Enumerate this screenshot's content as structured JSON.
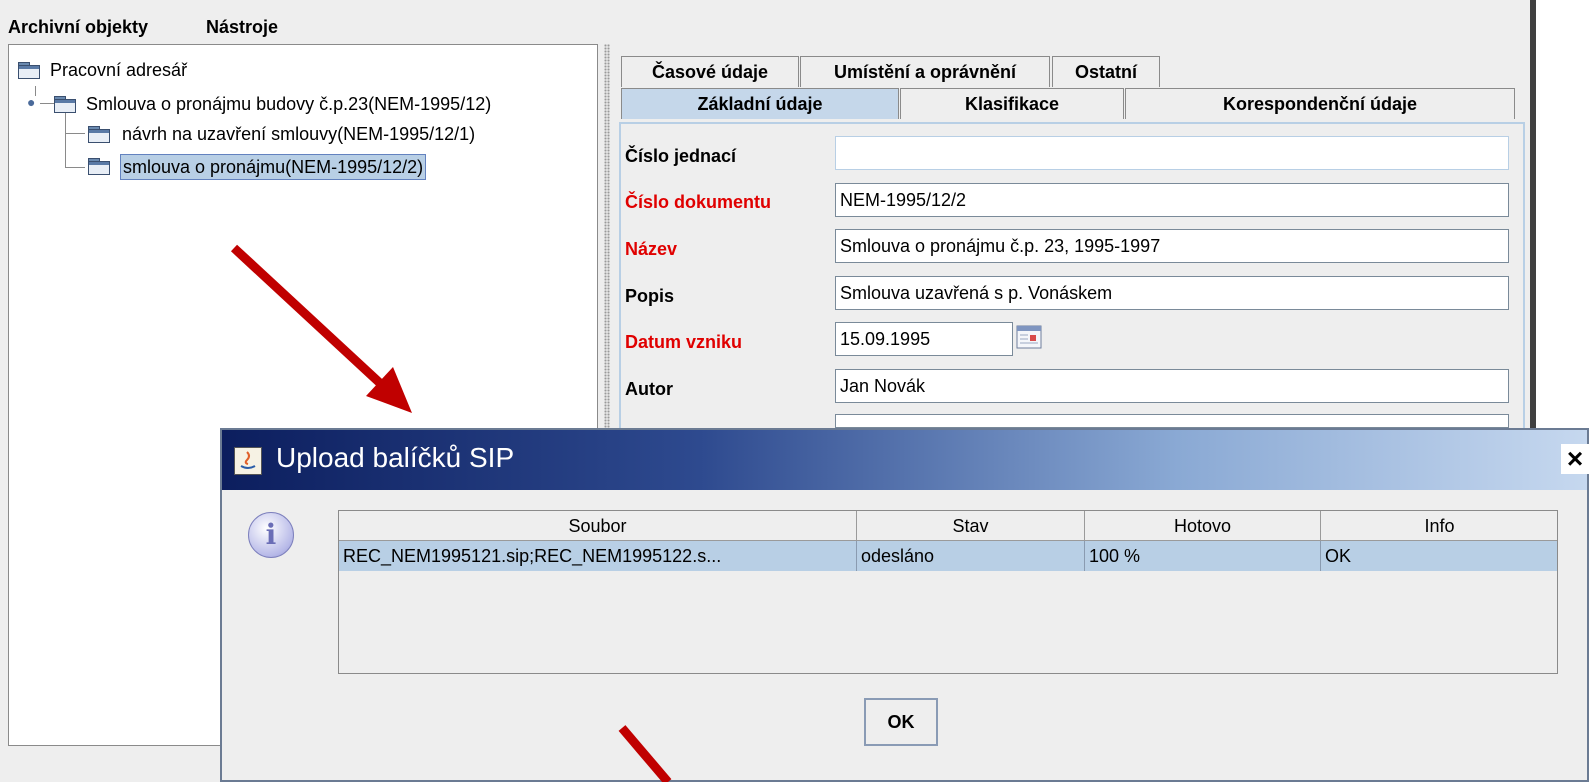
{
  "menu": {
    "items": [
      "Archivní objekty",
      "Nástroje"
    ]
  },
  "tree": {
    "root": "Pracovní adresář",
    "child": "Smlouva o pronájmu budovy č.p.23(NEM-1995/12)",
    "grandchildren": [
      "návrh na uzavření smlouvy(NEM-1995/12/1)",
      "smlouva o pronájmu(NEM-1995/12/2)"
    ],
    "selected_index": 1
  },
  "tabs": {
    "row1": [
      "Časové údaje",
      "Umístění a oprávnění",
      "Ostatní"
    ],
    "row2": [
      "Základní údaje",
      "Klasifikace",
      "Korespondenční údaje"
    ],
    "active": "Základní údaje"
  },
  "form": {
    "cislo_jednaci": {
      "label": "Číslo jednací",
      "value": ""
    },
    "cislo_dokumentu": {
      "label": "Číslo dokumentu",
      "value": "NEM-1995/12/2"
    },
    "nazev": {
      "label": "Název",
      "value": "Smlouva o pronájmu č.p. 23, 1995-1997"
    },
    "popis": {
      "label": "Popis",
      "value": "Smlouva uzavřená s p. Vonáskem"
    },
    "datum_vzniku": {
      "label": "Datum vzniku",
      "value": "15.09.1995"
    },
    "autor": {
      "label": "Autor",
      "value": "Jan Novák"
    }
  },
  "dialog": {
    "title": "Upload balíčků SIP",
    "close": "×",
    "columns": [
      "Soubor",
      "Stav",
      "Hotovo",
      "Info"
    ],
    "rows": [
      {
        "soubor": "REC_NEM1995121.sip;REC_NEM1995122.s...",
        "stav": "odesláno",
        "hotovo": "100 %",
        "info": "OK"
      }
    ],
    "ok_label": "OK"
  },
  "colors": {
    "annotation_arrow": "#c00000",
    "selection": "#b8cfe5",
    "required_label": "#e00000"
  }
}
